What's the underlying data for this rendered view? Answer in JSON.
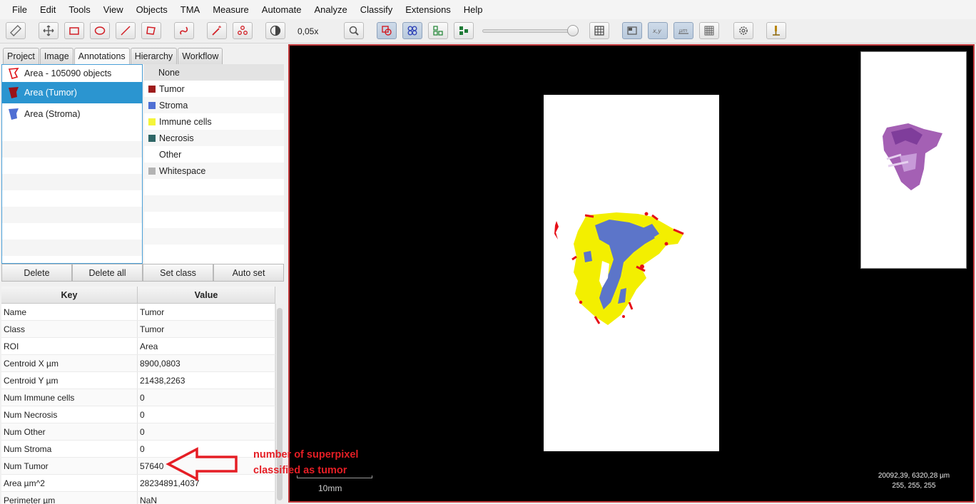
{
  "menu": [
    "File",
    "Edit",
    "Tools",
    "View",
    "Objects",
    "TMA",
    "Measure",
    "Automate",
    "Analyze",
    "Classify",
    "Extensions",
    "Help"
  ],
  "toolbar": {
    "zoom": "0,05x"
  },
  "tabs": [
    "Project",
    "Image",
    "Annotations",
    "Hierarchy",
    "Workflow"
  ],
  "annotations": [
    {
      "label": "Area - 105090 objects",
      "color": "#e0131a"
    },
    {
      "label": "Area (Tumor)",
      "color": "#9a1218"
    },
    {
      "label": "Area (Stroma)",
      "color": "#4f6fd4"
    }
  ],
  "classes": [
    {
      "name": "None",
      "color": ""
    },
    {
      "name": "Tumor",
      "color": "#9e1b1b"
    },
    {
      "name": "Stroma",
      "color": "#4f6fd4"
    },
    {
      "name": "Immune cells",
      "color": "#f5f53a"
    },
    {
      "name": "Necrosis",
      "color": "#2f6666"
    },
    {
      "name": "Other",
      "color": ""
    },
    {
      "name": "Whitespace",
      "color": "#b3b3b3"
    }
  ],
  "buttons": {
    "delete": "Delete",
    "delete_all": "Delete all",
    "set_class": "Set class",
    "auto_set": "Auto set"
  },
  "table": {
    "headers": {
      "key": "Key",
      "value": "Value"
    },
    "rows": [
      {
        "key": "Name",
        "value": "Tumor"
      },
      {
        "key": "Class",
        "value": "Tumor"
      },
      {
        "key": "ROI",
        "value": "Area"
      },
      {
        "key": "Centroid X µm",
        "value": "8900,0803"
      },
      {
        "key": "Centroid Y µm",
        "value": "21438,2263"
      },
      {
        "key": "Num Immune cells",
        "value": "0"
      },
      {
        "key": "Num Necrosis",
        "value": "0"
      },
      {
        "key": "Num Other",
        "value": "0"
      },
      {
        "key": "Num Stroma",
        "value": "0"
      },
      {
        "key": "Num Tumor",
        "value": "57640"
      },
      {
        "key": "Area µm^2",
        "value": "28234891,4037"
      },
      {
        "key": "Perimeter µm",
        "value": "NaN"
      }
    ]
  },
  "viewer": {
    "scale_label": "10mm",
    "cursor_position": "20092,39, 6320,28 µm",
    "pixel_value": "255, 255, 255"
  },
  "overlay_note": {
    "line1": "number of superpixel",
    "line2": "classified as tumor"
  }
}
